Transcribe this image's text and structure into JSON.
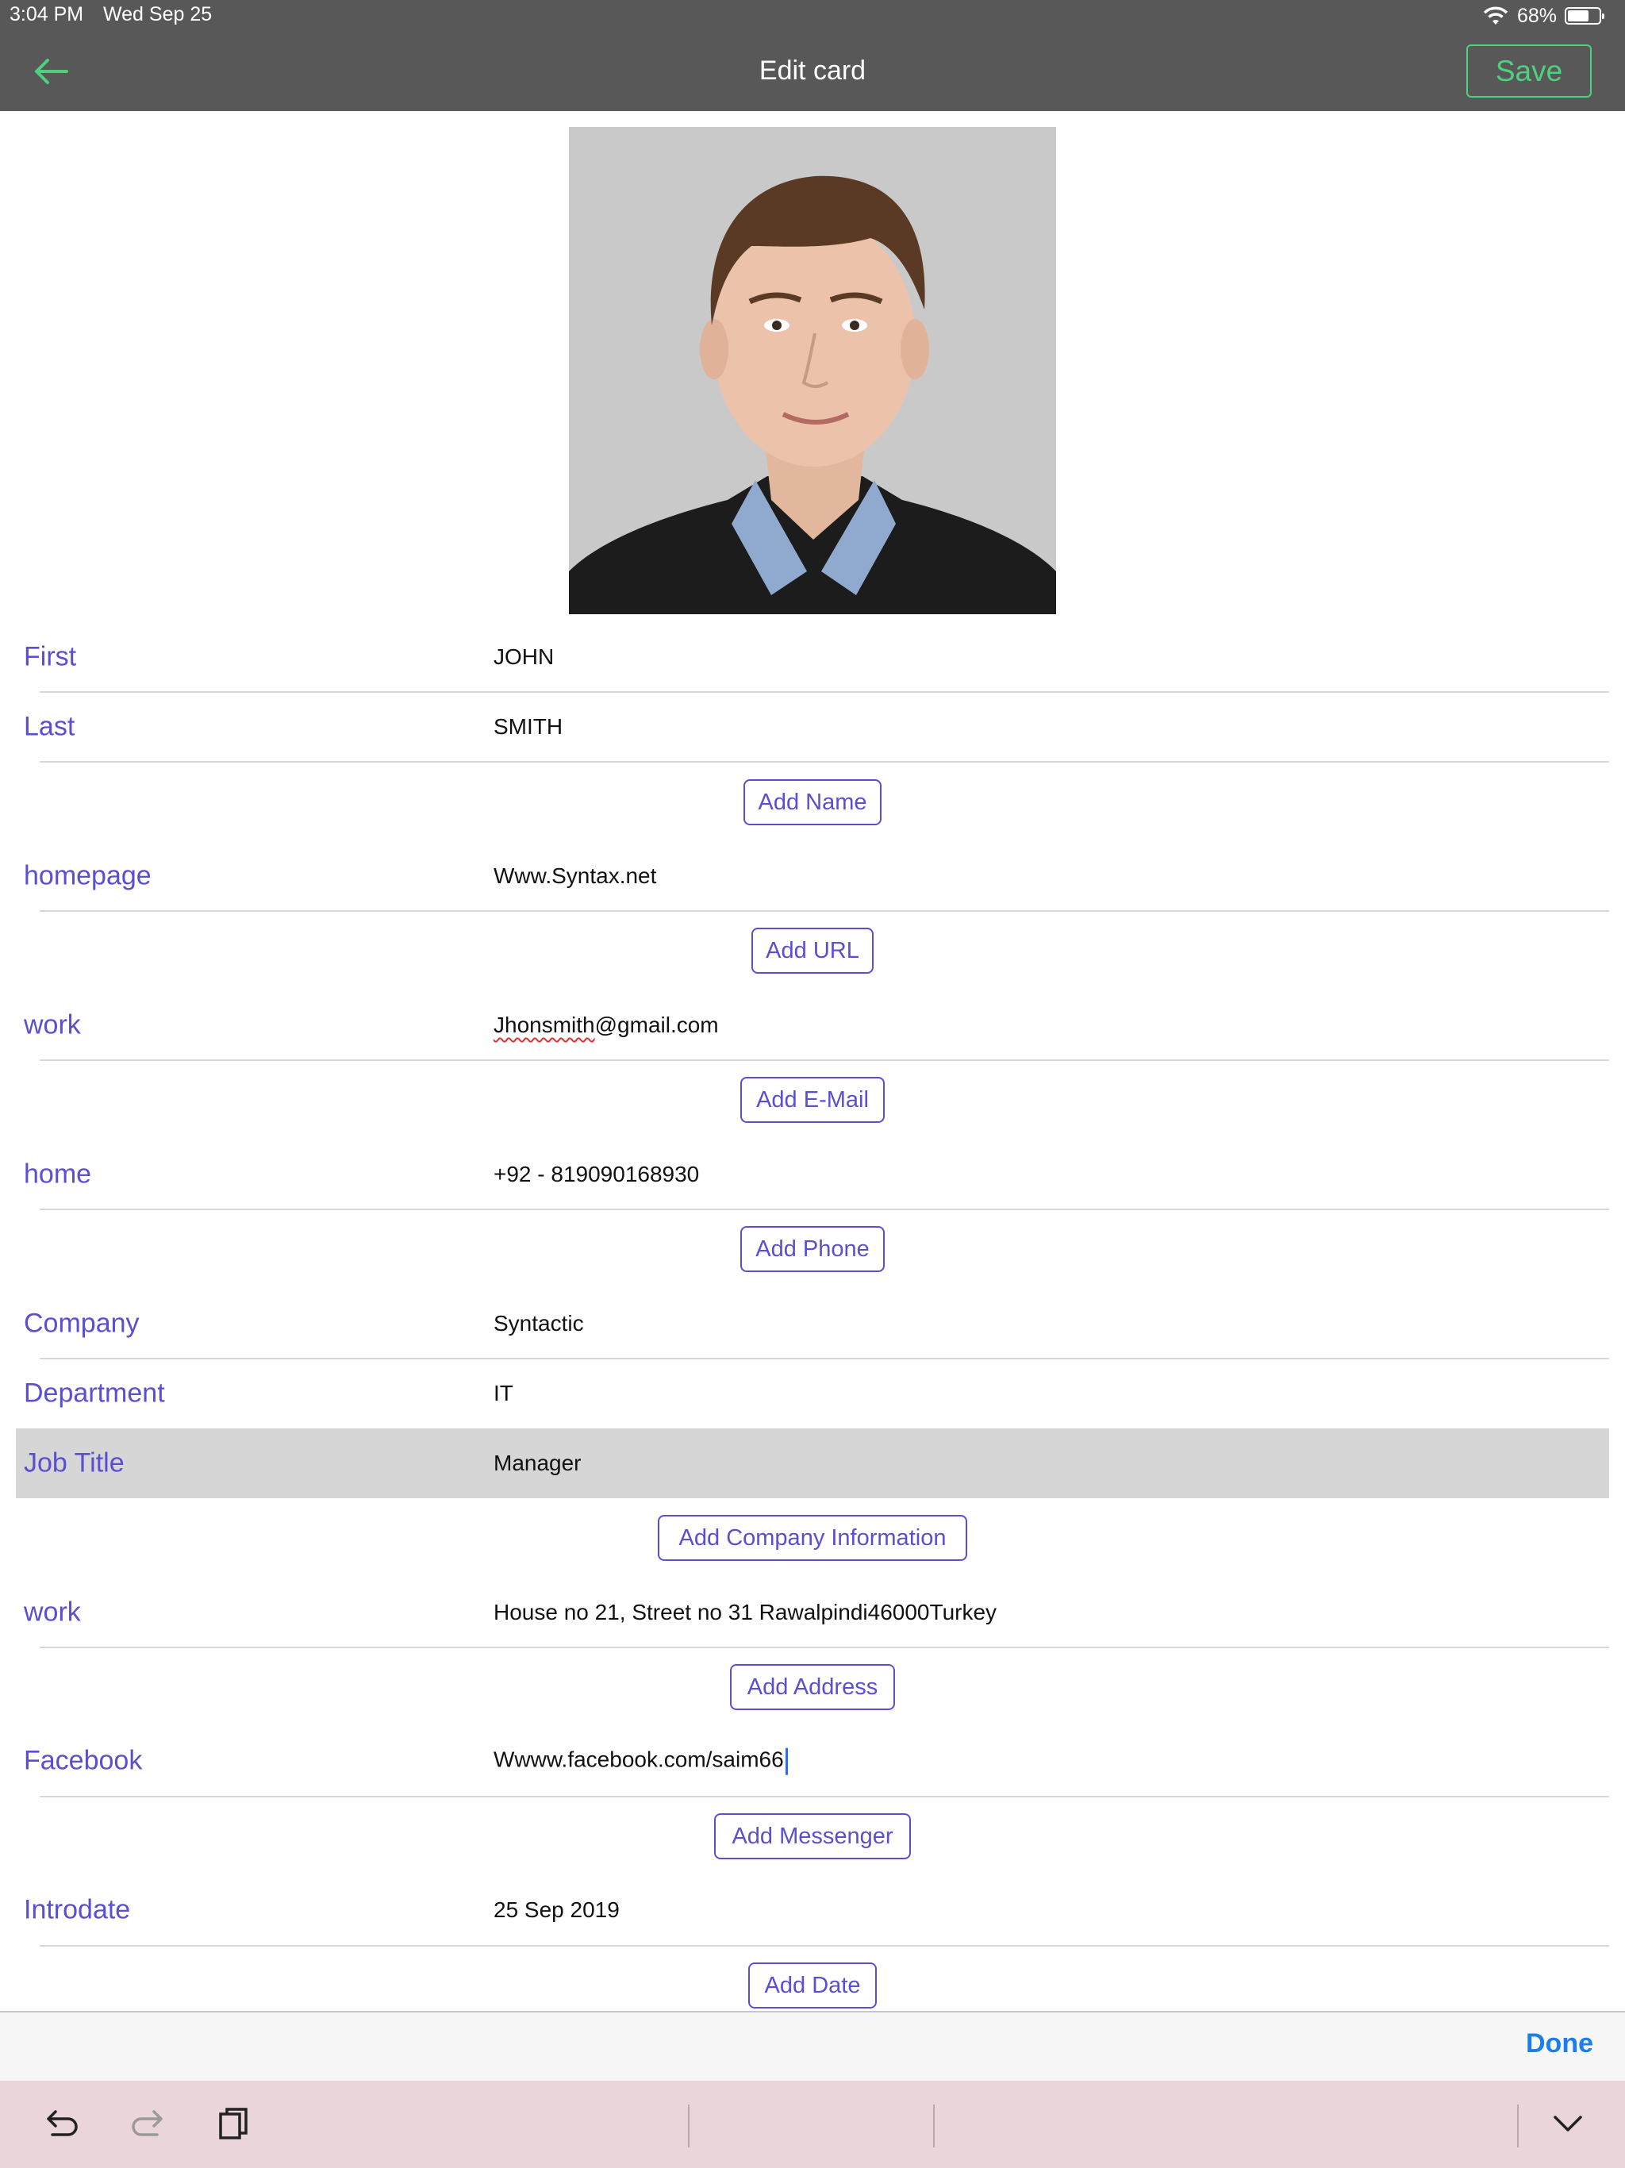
{
  "status_bar": {
    "time": "3:04 PM",
    "date": "Wed Sep 25",
    "battery_percent": "68%",
    "battery_level": 0.68
  },
  "nav": {
    "title": "Edit card",
    "save_label": "Save"
  },
  "photo": {
    "icon": "profile-photo"
  },
  "fields": {
    "first": {
      "label": "First",
      "value": "JOHN"
    },
    "last": {
      "label": "Last",
      "value": "SMITH"
    },
    "homepage": {
      "label": "homepage",
      "value": "Www.Syntax.net"
    },
    "email": {
      "label": "work",
      "value_misspelled": "Jhonsmith",
      "value_rest": "@gmail.com"
    },
    "phone": {
      "label": "home",
      "value": "+92 - 819090168930"
    },
    "company": {
      "label": "Company",
      "value": "Syntactic"
    },
    "department": {
      "label": "Department",
      "value": "IT"
    },
    "job_title": {
      "label": "Job Title",
      "value": "Manager"
    },
    "address": {
      "label": "work",
      "value": "House no 21, Street no 31 Rawalpindi46000Turkey"
    },
    "messenger": {
      "label": "Facebook",
      "value": "Wwww.facebook.com/saim66"
    },
    "date": {
      "label": "Introdate",
      "value": "25 Sep 2019"
    }
  },
  "buttons": {
    "add_name": "Add Name",
    "add_url": "Add URL",
    "add_email": "Add E-Mail",
    "add_phone": "Add Phone",
    "add_company": "Add Company Information",
    "add_address": "Add Address",
    "add_messenger": "Add Messenger",
    "add_date": "Add Date"
  },
  "keyboard": {
    "done_label": "Done"
  },
  "colors": {
    "accent": "#5a4fd0",
    "save_green": "#4ed07e",
    "done_blue": "#1a7ef0",
    "nav_bg": "#585858",
    "highlight_row": "#d6d6d7"
  }
}
